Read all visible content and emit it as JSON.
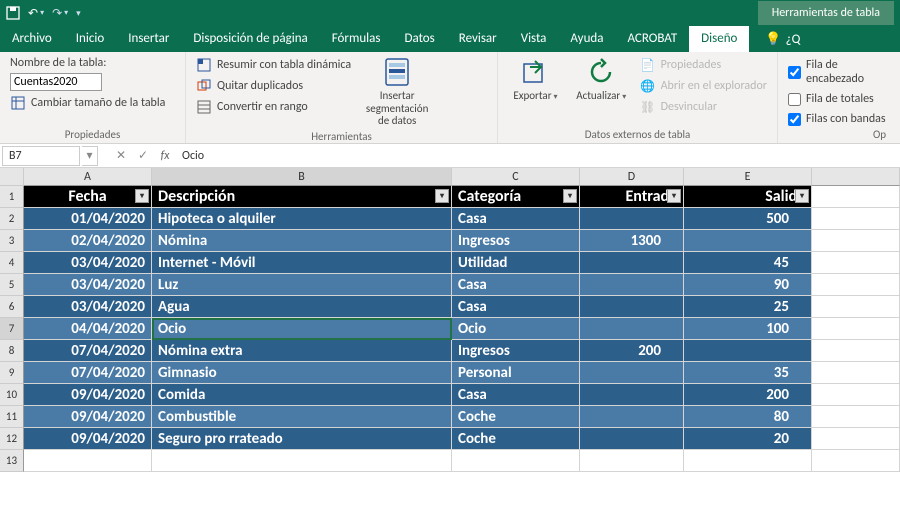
{
  "titlebar": {
    "context_tab": "Herramientas de tabla"
  },
  "tabs": {
    "file": "Archivo",
    "home": "Inicio",
    "insert": "Insertar",
    "layout": "Disposición de página",
    "formulas": "Fórmulas",
    "data": "Datos",
    "review": "Revisar",
    "view": "Vista",
    "help": "Ayuda",
    "acrobat": "ACROBAT",
    "design": "Diseño",
    "tell": "¿Q"
  },
  "ribbon": {
    "props": {
      "name_label": "Nombre de la tabla:",
      "table_name": "Cuentas2020",
      "resize": "Cambiar tamaño de la tabla",
      "title": "Propiedades"
    },
    "tools": {
      "pivot": "Resumir con tabla dinámica",
      "dedup": "Quitar duplicados",
      "range": "Convertir en rango",
      "slicer": "Insertar segmentación de datos",
      "title": "Herramientas"
    },
    "ext": {
      "export": "Exportar",
      "refresh": "Actualizar",
      "props": "Propiedades",
      "open": "Abrir en el explorador",
      "unlink": "Desvincular",
      "title": "Datos externos de tabla"
    },
    "opts": {
      "header": "Fila de encabezado",
      "totals": "Fila de totales",
      "banded": "Filas con bandas",
      "title": "Op"
    }
  },
  "fx": {
    "cell": "B7",
    "value": "Ocio"
  },
  "cols": [
    "A",
    "B",
    "C",
    "D",
    "E"
  ],
  "headers": {
    "fecha": "Fecha",
    "desc": "Descripción",
    "cat": "Categoría",
    "in": "Entrada",
    "out": "Salida"
  },
  "rows": [
    {
      "fecha": "01/04/2020",
      "desc": "Hipoteca o alquiler",
      "cat": "Casa",
      "in": "",
      "out": "500"
    },
    {
      "fecha": "02/04/2020",
      "desc": "Nómina",
      "cat": "Ingresos",
      "in": "1300",
      "out": ""
    },
    {
      "fecha": "03/04/2020",
      "desc": "Internet - Móvil",
      "cat": "Utilidad",
      "in": "",
      "out": "45"
    },
    {
      "fecha": "03/04/2020",
      "desc": "Luz",
      "cat": "Casa",
      "in": "",
      "out": "90"
    },
    {
      "fecha": "03/04/2020",
      "desc": "Agua",
      "cat": "Casa",
      "in": "",
      "out": "25"
    },
    {
      "fecha": "04/04/2020",
      "desc": "Ocio",
      "cat": "Ocio",
      "in": "",
      "out": "100"
    },
    {
      "fecha": "07/04/2020",
      "desc": "Nómina extra",
      "cat": "Ingresos",
      "in": "200",
      "out": ""
    },
    {
      "fecha": "07/04/2020",
      "desc": "Gimnasio",
      "cat": "Personal",
      "in": "",
      "out": "35"
    },
    {
      "fecha": "09/04/2020",
      "desc": "Comida",
      "cat": "Casa",
      "in": "",
      "out": "200"
    },
    {
      "fecha": "09/04/2020",
      "desc": "Combustible",
      "cat": "Coche",
      "in": "",
      "out": "80"
    },
    {
      "fecha": "09/04/2020",
      "desc": "Seguro pro rrateado",
      "cat": "Coche",
      "in": "",
      "out": "20"
    }
  ],
  "selected_row_index": 5
}
